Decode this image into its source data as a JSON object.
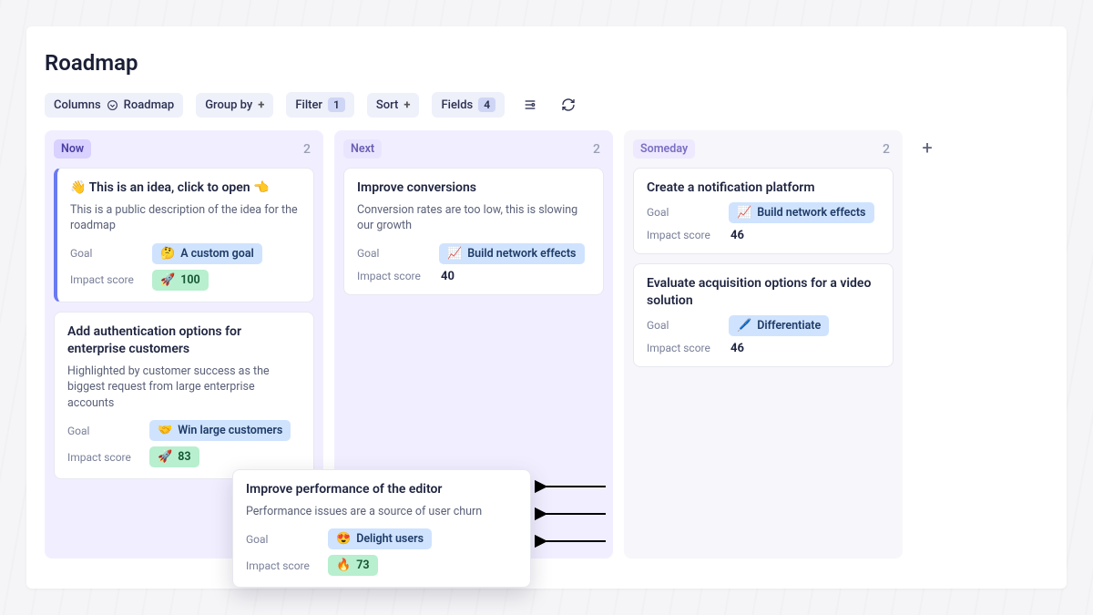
{
  "page": {
    "title": "Roadmap"
  },
  "toolbar": {
    "columns": {
      "label": "Columns",
      "value": "Roadmap"
    },
    "groupby": {
      "label": "Group by"
    },
    "filter": {
      "label": "Filter",
      "count": "1"
    },
    "sort": {
      "label": "Sort"
    },
    "fields": {
      "label": "Fields",
      "count": "4"
    }
  },
  "labels": {
    "goal": "Goal",
    "impact": "Impact score"
  },
  "columns": [
    {
      "key": "now",
      "name": "Now",
      "count": "2",
      "cards": [
        {
          "title": "👋 This is an idea, click to open 👈",
          "desc": "This is a public description of the idea for the roadmap",
          "goal_emoji": "🤔",
          "goal_text": "A custom goal",
          "impact_emoji": "🚀",
          "impact_value": "100",
          "highlight": true,
          "impact_style": "pill"
        },
        {
          "title": "Add authentication options for enterprise customers",
          "desc": "Highlighted by customer success as the biggest request from large enterprise accounts",
          "goal_emoji": "🤝",
          "goal_text": "Win large customers",
          "impact_emoji": "🚀",
          "impact_value": "83",
          "impact_style": "pill"
        }
      ]
    },
    {
      "key": "next",
      "name": "Next",
      "count": "2",
      "cards": [
        {
          "title": "Improve conversions",
          "desc": "Conversion rates are too low, this is slowing our growth",
          "goal_emoji": "📈",
          "goal_text": "Build network effects",
          "impact_value": "40",
          "impact_style": "plain"
        }
      ]
    },
    {
      "key": "someday",
      "name": "Someday",
      "count": "2",
      "cards": [
        {
          "title": "Create a notification platform",
          "goal_emoji": "📈",
          "goal_text": "Build network effects",
          "impact_value": "46",
          "impact_style": "plain"
        },
        {
          "title": "Evaluate acquisition options for a video solution",
          "goal_emoji": "🖊️",
          "goal_text": "Differentiate",
          "impact_value": "46",
          "impact_style": "plain"
        }
      ]
    }
  ],
  "drag_card": {
    "title": "Improve performance of the editor",
    "desc": "Performance issues are a source of user churn",
    "goal_emoji": "😍",
    "goal_text": "Delight users",
    "impact_emoji": "🔥",
    "impact_value": "73"
  }
}
